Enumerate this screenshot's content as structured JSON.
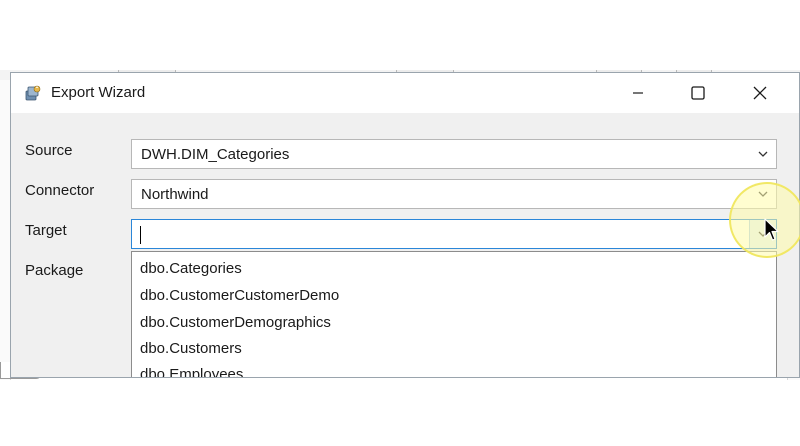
{
  "window": {
    "title": "Export Wizard",
    "icon": "export-wizard-app-icon"
  },
  "controls": {
    "minimize": "minimize-icon",
    "maximize": "maximize-icon",
    "close": "close-icon"
  },
  "form": {
    "source_label": "Source",
    "source_value": "DWH.DIM_Categories",
    "connector_label": "Connector",
    "connector_value": "Northwind",
    "target_label": "Target",
    "target_value": "",
    "package_label": "Package"
  },
  "target_dropdown": {
    "options": [
      "dbo.Categories",
      "dbo.CustomerCustomerDemo",
      "dbo.CustomerDemographics",
      "dbo.Customers",
      "dbo.Employees"
    ]
  },
  "colors": {
    "focus_border": "#2a86d8",
    "cursor_highlight": "#fffcaa"
  }
}
